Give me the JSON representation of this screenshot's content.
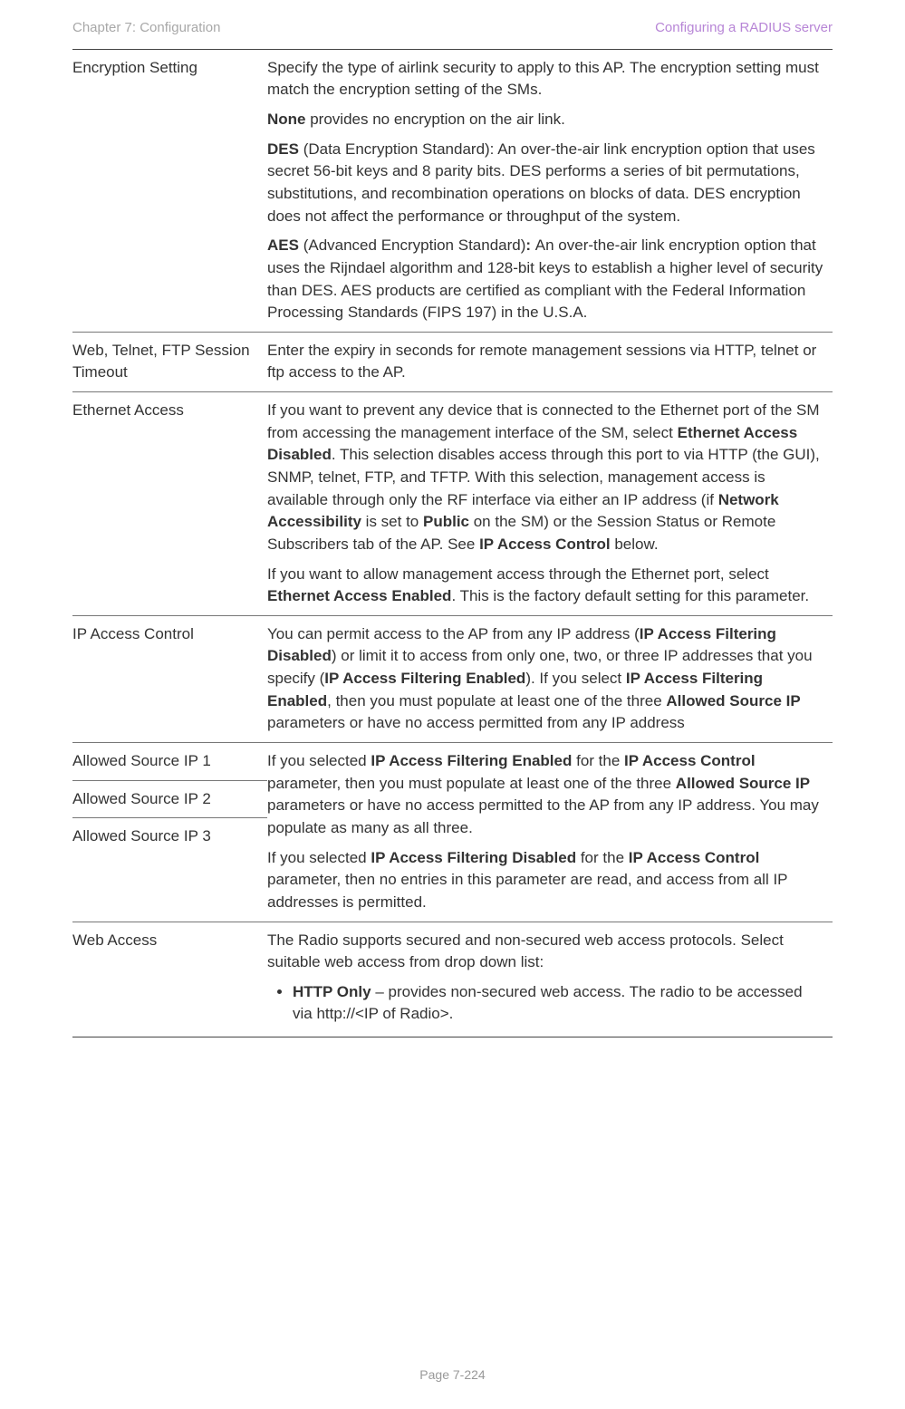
{
  "header": {
    "left": "Chapter 7:  Configuration",
    "right": "Configuring a RADIUS server"
  },
  "footer": "Page 7-224",
  "rows": {
    "encryption": {
      "label": "Encryption Setting",
      "p1": "Specify the type of airlink security to apply to this AP. The encryption setting must match the encryption setting of the SMs.",
      "p2a": "None",
      "p2b": " provides no encryption on the air link.",
      "p3a": "DES",
      "p3b": " (Data Encryption Standard): An over-the-air link encryption option that uses secret 56-bit keys and 8 parity bits. DES performs a series of bit permutations, substitutions, and recombination operations on blocks of data. DES encryption does not affect the performance or throughput of the system.",
      "p4a": "AES",
      "p4b": " (Advanced Encryption Standard)",
      "p4c": ": ",
      "p4d": "An over-the-air link encryption option that uses the Rijndael algorithm and 128-bit keys to establish a higher level of security than DES. AES products are certified as compliant with the Federal Information Processing Standards (FIPS 197) in the U.S.A."
    },
    "timeout": {
      "label": "Web, Telnet, FTP Session Timeout",
      "p1": "Enter the expiry in seconds for remote management sessions via HTTP, telnet or ftp access to the AP."
    },
    "ethernet": {
      "label": "Ethernet Access",
      "p1a": "If you want to prevent any device that is connected to the Ethernet port of the SM from accessing the management interface of the SM, select ",
      "p1b": "Ethernet Access Disabled",
      "p1c": ". This selection disables access through this port to via HTTP (the GUI), SNMP, telnet, FTP, and TFTP. With this selection, management access is available through only the RF interface via either an IP address (if ",
      "p1d": "Network Accessibility",
      "p1e": " is set to ",
      "p1f": "Public",
      "p1g": " on the SM) or the Session Status or Remote Subscribers tab of the AP. See ",
      "p1h": "IP Access Control",
      "p1i": " below.",
      "p2a": "If you want to allow management access through the Ethernet port, select ",
      "p2b": "Ethernet Access Enabled",
      "p2c": ". This is the factory default setting for this parameter."
    },
    "ipac": {
      "label": "IP Access Control",
      "p1a": "You can permit access to the AP from any IP address (",
      "p1b": "IP Access Filtering Disabled",
      "p1c": ") or limit it to access from only one, two, or three IP addresses that you specify (",
      "p1d": "IP Access Filtering Enabled",
      "p1e": "). If you select ",
      "p1f": "IP Access Filtering Enabled",
      "p1g": ", then you must populate at least one of the three ",
      "p1h": "Allowed Source IP",
      "p1i": " parameters or have no access permitted from any IP address"
    },
    "src": {
      "l1": "Allowed Source IP 1",
      "l2": "Allowed Source IP 2",
      "l3": "Allowed Source IP 3",
      "p1a": "If you selected ",
      "p1b": "IP Access Filtering Enabled",
      "p1c": " for the ",
      "p1d": "IP Access Control",
      "p1e": " parameter, then you must populate at least one of the three ",
      "p1f": "Allowed Source IP",
      "p1g": " parameters or have no access permitted to the AP from any IP address. You may populate as many as all three.",
      "p2a": "If you selected ",
      "p2b": "IP Access Filtering Disabled",
      "p2c": " for the ",
      "p2d": "IP Access Control",
      "p2e": " parameter, then no entries in this parameter are read, and access from all IP addresses is permitted."
    },
    "web": {
      "label": "Web Access",
      "p1": "The Radio supports secured and non-secured web access protocols. Select suitable web access from drop down list:",
      "li1a": "HTTP Only",
      "li1b": " – provides non-secured web access. The radio to be accessed via http://<IP of Radio>."
    }
  }
}
